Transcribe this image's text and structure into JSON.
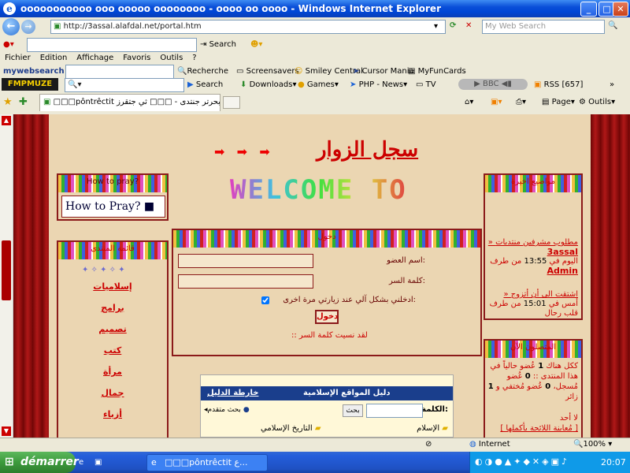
{
  "window": {
    "title": "ooooooooooo ooo ooooo oooooooo - oooo oo oooo - Windows Internet Explorer"
  },
  "address_bar": {
    "url": "http://3assal.alafdal.net/portal.htm",
    "search_placeholder": "My Web Search"
  },
  "toolbar1": {
    "search_label": "Search"
  },
  "menu": [
    "Fichier",
    "Edition",
    "Affichage",
    "Favoris",
    "Outils",
    "?"
  ],
  "mywebsearch": {
    "logo": "mywebsearch",
    "recherche": "Recherche",
    "items": [
      "Screensavers",
      "Smiley Central",
      "Cursor Mania",
      "MyFunCards"
    ]
  },
  "fmp_toolbar": {
    "logo": "FMPMUZE",
    "search": "Search",
    "items": [
      "Downloads",
      "Games",
      "PHP - News",
      "TV",
      "BBC",
      "RSS [657]"
    ]
  },
  "tab": {
    "label": "□□□pôntrêctit مدي بحرتر جنتدى - □□□ ثي جتقرز"
  },
  "command_bar": {
    "page": "Page",
    "outils": "Outils"
  },
  "page": {
    "headline": "سجل الزوار",
    "welcome": "WELCOME TO",
    "how_to_pray": {
      "title": "How to pray?",
      "button": "How to Pray?"
    },
    "login": {
      "title": "دخول",
      "username_label": "اسم العضو:",
      "password_label": "كلمة السر:",
      "remember_label": "ادخلني بشكل آلي عند زيارتي مرة اخرى:",
      "submit": "دخول",
      "forgot": ":: لقد نسيت كلمة السر"
    },
    "left_menu": {
      "title": "قائمة المنتدى",
      "items": [
        "إسلاميات",
        "برامج",
        "تصميم",
        "كتب",
        "مرأة",
        "جمال",
        "أزياء"
      ]
    },
    "recent": {
      "title": "مواضيع اخيرة",
      "items": [
        {
          "text": "» مطلوب مشرفين منتديات",
          "user": "3assal",
          "time_prefix": "اليوم في",
          "time": "13:55",
          "by": "من طرف",
          "author": "Admin"
        },
        {
          "text": "» اشتقت الى أن أتزوج",
          "time_prefix": "أمس في",
          "time": "15:01",
          "by": "من طرف",
          "author": "قلب رحال"
        }
      ]
    },
    "online": {
      "title": "المتصلون الآن",
      "line1": "ككل هناك",
      "count": "1",
      "line1b": "عُضو حالياً في هذا المنتدى :: ",
      "registered": "0",
      "line2": "عُضو مُسجل،",
      "hidden": "0",
      "line3": "عُضو مُختفي و",
      "guests": "1",
      "line4": "زائر",
      "none": "لا أحد",
      "link": "[ مُعاينة اللائحة بأكملها ]"
    },
    "directory": {
      "title": "دليل المواقع الإسلامية",
      "map": "خارطة الدليل",
      "search_label": "الكلمة:",
      "search_btn": "بحث",
      "advanced": "بحث متقدم",
      "cat1": "الإسلام",
      "cat2": "التاريخ الإسلامي"
    }
  },
  "status_bar": {
    "zone": "Internet",
    "zoom": "100%"
  },
  "taskbar": {
    "start": "démarrer",
    "task": "□□□pôntrêctit ع...",
    "clock": "20:07"
  }
}
